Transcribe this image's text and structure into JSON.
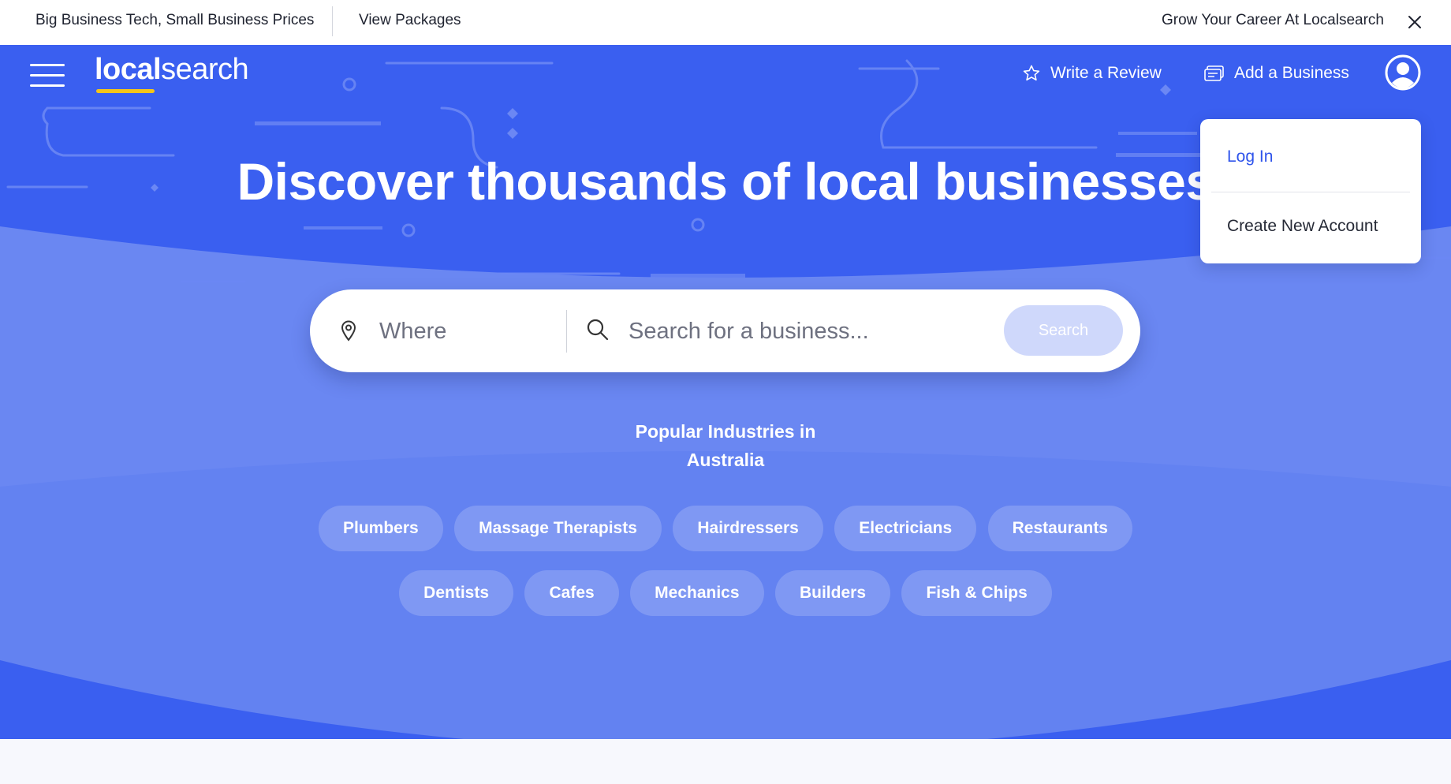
{
  "topbar": {
    "promo": "Big Business Tech, Small Business Prices",
    "packages": "View Packages",
    "career": "Grow Your Career At Localsearch"
  },
  "header": {
    "logo_bold": "local",
    "logo_light": "search",
    "write_review": "Write a Review",
    "add_business": "Add a Business"
  },
  "hero": {
    "headline": "Discover thousands of local businesses"
  },
  "search": {
    "where_placeholder": "Where",
    "what_placeholder": "Search for a business...",
    "button": "Search"
  },
  "popular": {
    "line1": "Popular Industries in",
    "line2": "Australia"
  },
  "industries_row1": [
    "Plumbers",
    "Massage Therapists",
    "Hairdressers",
    "Electricians",
    "Restaurants"
  ],
  "industries_row2": [
    "Dentists",
    "Cafes",
    "Mechanics",
    "Builders",
    "Fish & Chips"
  ],
  "dropdown": {
    "login": "Log In",
    "create": "Create New Account"
  },
  "colors": {
    "brand_blue": "#3a5ff0",
    "logo_underline": "#f5c518",
    "link_blue": "#2f54eb"
  },
  "icons": {
    "menu": "hamburger-icon",
    "review": "star-icon",
    "business": "card-icon",
    "account": "user-icon",
    "where": "location-pin-icon",
    "search": "search-icon",
    "close": "close-icon"
  }
}
